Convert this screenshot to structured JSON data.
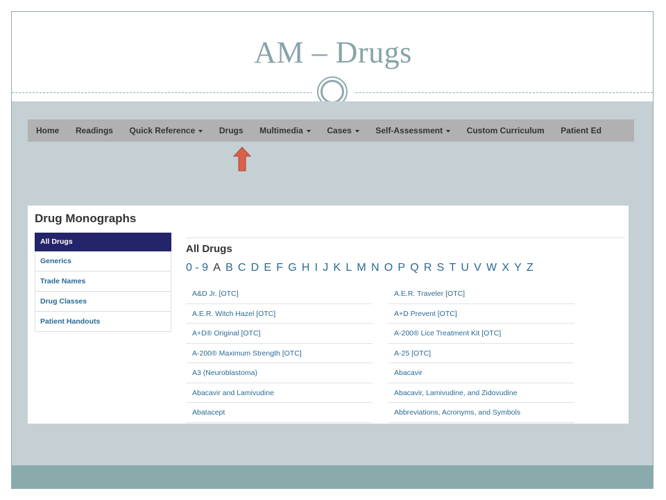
{
  "slide": {
    "title": "AM – Drugs"
  },
  "nav": {
    "items": [
      {
        "label": "Home",
        "dropdown": false
      },
      {
        "label": "Readings",
        "dropdown": false
      },
      {
        "label": "Quick Reference",
        "dropdown": true
      },
      {
        "label": "Drugs",
        "dropdown": false
      },
      {
        "label": "Multimedia",
        "dropdown": true
      },
      {
        "label": "Cases",
        "dropdown": true
      },
      {
        "label": "Self-Assessment",
        "dropdown": true
      },
      {
        "label": "Custom Curriculum",
        "dropdown": false
      },
      {
        "label": "Patient Ed",
        "dropdown": false
      }
    ]
  },
  "annotation": {
    "arrow_points_to": "Drugs",
    "arrow_color": "#d9604a"
  },
  "panel": {
    "title": "Drug Monographs",
    "sidebar": [
      {
        "label": "All Drugs",
        "active": true
      },
      {
        "label": "Generics",
        "active": false
      },
      {
        "label": "Trade Names",
        "active": false
      },
      {
        "label": "Drug Classes",
        "active": false
      },
      {
        "label": "Patient Handouts",
        "active": false
      }
    ],
    "main_title": "All Drugs",
    "alphabet": [
      "0 - 9",
      "A",
      "B",
      "C",
      "D",
      "E",
      "F",
      "G",
      "H",
      "I",
      "J",
      "K",
      "L",
      "M",
      "N",
      "O",
      "P",
      "Q",
      "R",
      "S",
      "T",
      "U",
      "V",
      "W",
      "X",
      "Y",
      "Z"
    ],
    "current_letter": "A",
    "drugs_left": [
      "A&D Jr. [OTC]",
      "A.E.R. Witch Hazel [OTC]",
      "A+D® Original [OTC]",
      "A-200® Maximum Strength [OTC]",
      "A3 (Neuroblastoma)",
      "Abacavir and Lamivudine",
      "Abatacept"
    ],
    "drugs_right": [
      "A.E.R. Traveler [OTC]",
      "A+D Prevent [OTC]",
      "A-200® Lice Treatment Kit [OTC]",
      "A-25 [OTC]",
      "Abacavir",
      "Abacavir, Lamivudine, and Zidovudine",
      "Abbreviations, Acronyms, and Symbols"
    ]
  },
  "colors": {
    "title": "#87a4a8",
    "accent_teal": "#89abab",
    "content_bg": "#c5d0d5",
    "navbar_bg": "#b1b1b1",
    "active_tab": "#24246a",
    "link": "#2a6a95"
  }
}
